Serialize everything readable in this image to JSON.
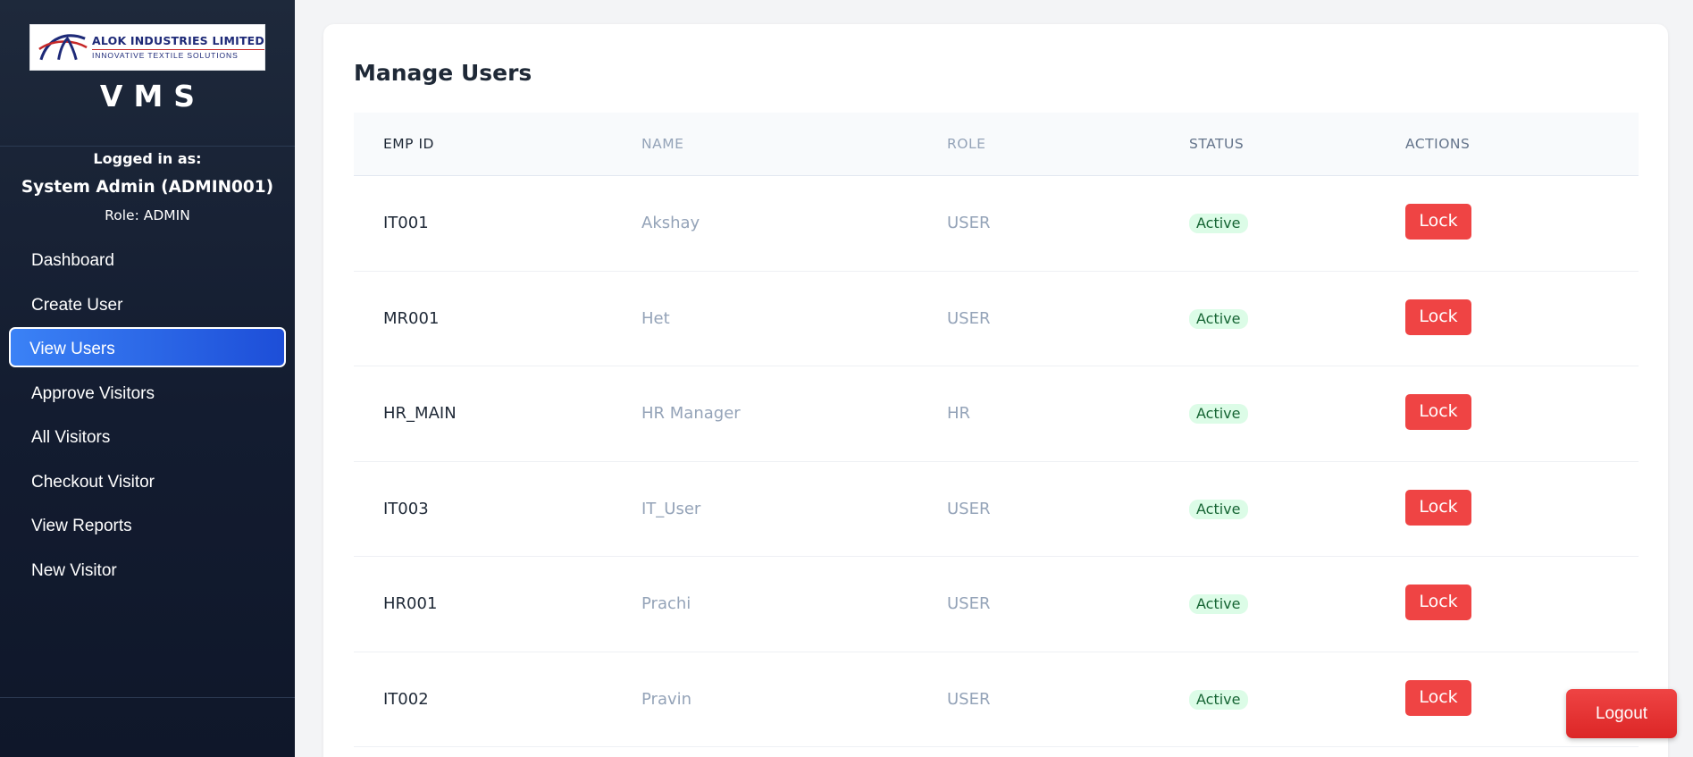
{
  "brand": {
    "company": "ALOK INDUSTRIES LIMITED",
    "tagline": "INNOVATIVE TEXTILE SOLUTIONS",
    "app_title": "VMS",
    "logo_colors": {
      "arc_blue": "#1e2a78",
      "arc_red": "#c62828"
    }
  },
  "session": {
    "label": "Logged in as:",
    "user": "System Admin (ADMIN001)",
    "role": "Role: ADMIN"
  },
  "nav": {
    "items": [
      {
        "label": "Dashboard",
        "active": false
      },
      {
        "label": "Create User",
        "active": false
      },
      {
        "label": "View Users",
        "active": true
      },
      {
        "label": "Approve Visitors",
        "active": false
      },
      {
        "label": "All Visitors",
        "active": false
      },
      {
        "label": "Checkout Visitor",
        "active": false
      },
      {
        "label": "View Reports",
        "active": false
      },
      {
        "label": "New Visitor",
        "active": false
      }
    ]
  },
  "main": {
    "title": "Manage Users",
    "columns": [
      "EMP ID",
      "NAME",
      "ROLE",
      "STATUS",
      "ACTIONS"
    ],
    "rows": [
      {
        "emp_id": "IT001",
        "name": "Akshay",
        "role": "USER",
        "status": "Active",
        "action": "Lock"
      },
      {
        "emp_id": "MR001",
        "name": "Het",
        "role": "USER",
        "status": "Active",
        "action": "Lock"
      },
      {
        "emp_id": "HR_MAIN",
        "name": "HR Manager",
        "role": "HR",
        "status": "Active",
        "action": "Lock"
      },
      {
        "emp_id": "IT003",
        "name": "IT_User",
        "role": "USER",
        "status": "Active",
        "action": "Lock"
      },
      {
        "emp_id": "HR001",
        "name": "Prachi",
        "role": "USER",
        "status": "Active",
        "action": "Lock"
      },
      {
        "emp_id": "IT002",
        "name": "Pravin",
        "role": "USER",
        "status": "Active",
        "action": "Lock"
      }
    ]
  },
  "logout_label": "Logout",
  "colors": {
    "sidebar_bg": "#1e293b",
    "active_nav": "#2563eb",
    "danger": "#ef4444",
    "status_active_bg": "#dcfce7",
    "status_active_text": "#166534"
  }
}
